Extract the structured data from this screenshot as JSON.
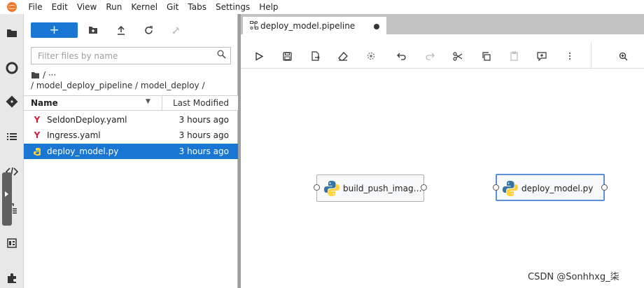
{
  "menu": {
    "items": [
      "File",
      "Edit",
      "View",
      "Run",
      "Kernel",
      "Git",
      "Tabs",
      "Settings",
      "Help"
    ]
  },
  "activity_bar": {
    "icons": [
      "folder-icon",
      "running-kernels-icon",
      "git-icon",
      "toc-icon",
      "code-snippets-icon",
      "property-inspector-icon",
      "pipeline-components-icon",
      "extensions-icon"
    ]
  },
  "file_browser": {
    "new_label": "+",
    "filter_placeholder": "Filter files by name",
    "breadcrumb_ellipsis": "/ ···",
    "path": "/ model_deploy_pipeline / model_deploy /",
    "columns": {
      "name": "Name",
      "modified": "Last Modified"
    },
    "files": [
      {
        "name": "SeldonDeploy.yaml",
        "modified": "3 hours ago",
        "type": "yaml"
      },
      {
        "name": "Ingress.yaml",
        "modified": "3 hours ago",
        "type": "yaml"
      },
      {
        "name": "deploy_model.py",
        "modified": "3 hours ago",
        "type": "python",
        "selected": true
      }
    ]
  },
  "editor": {
    "tab_title": "deploy_model.pipeline",
    "tab_dirty": true
  },
  "pipeline": {
    "nodes": [
      {
        "label": "build_push_imag…",
        "selected": false
      },
      {
        "label": "deploy_model.py",
        "selected": true
      }
    ]
  },
  "watermark": "CSDN @Sonhhxg_柒",
  "colors": {
    "accent": "#1976d2",
    "yaml_icon": "#cc1f3d",
    "node_selected_border": "#5b8fd8"
  }
}
